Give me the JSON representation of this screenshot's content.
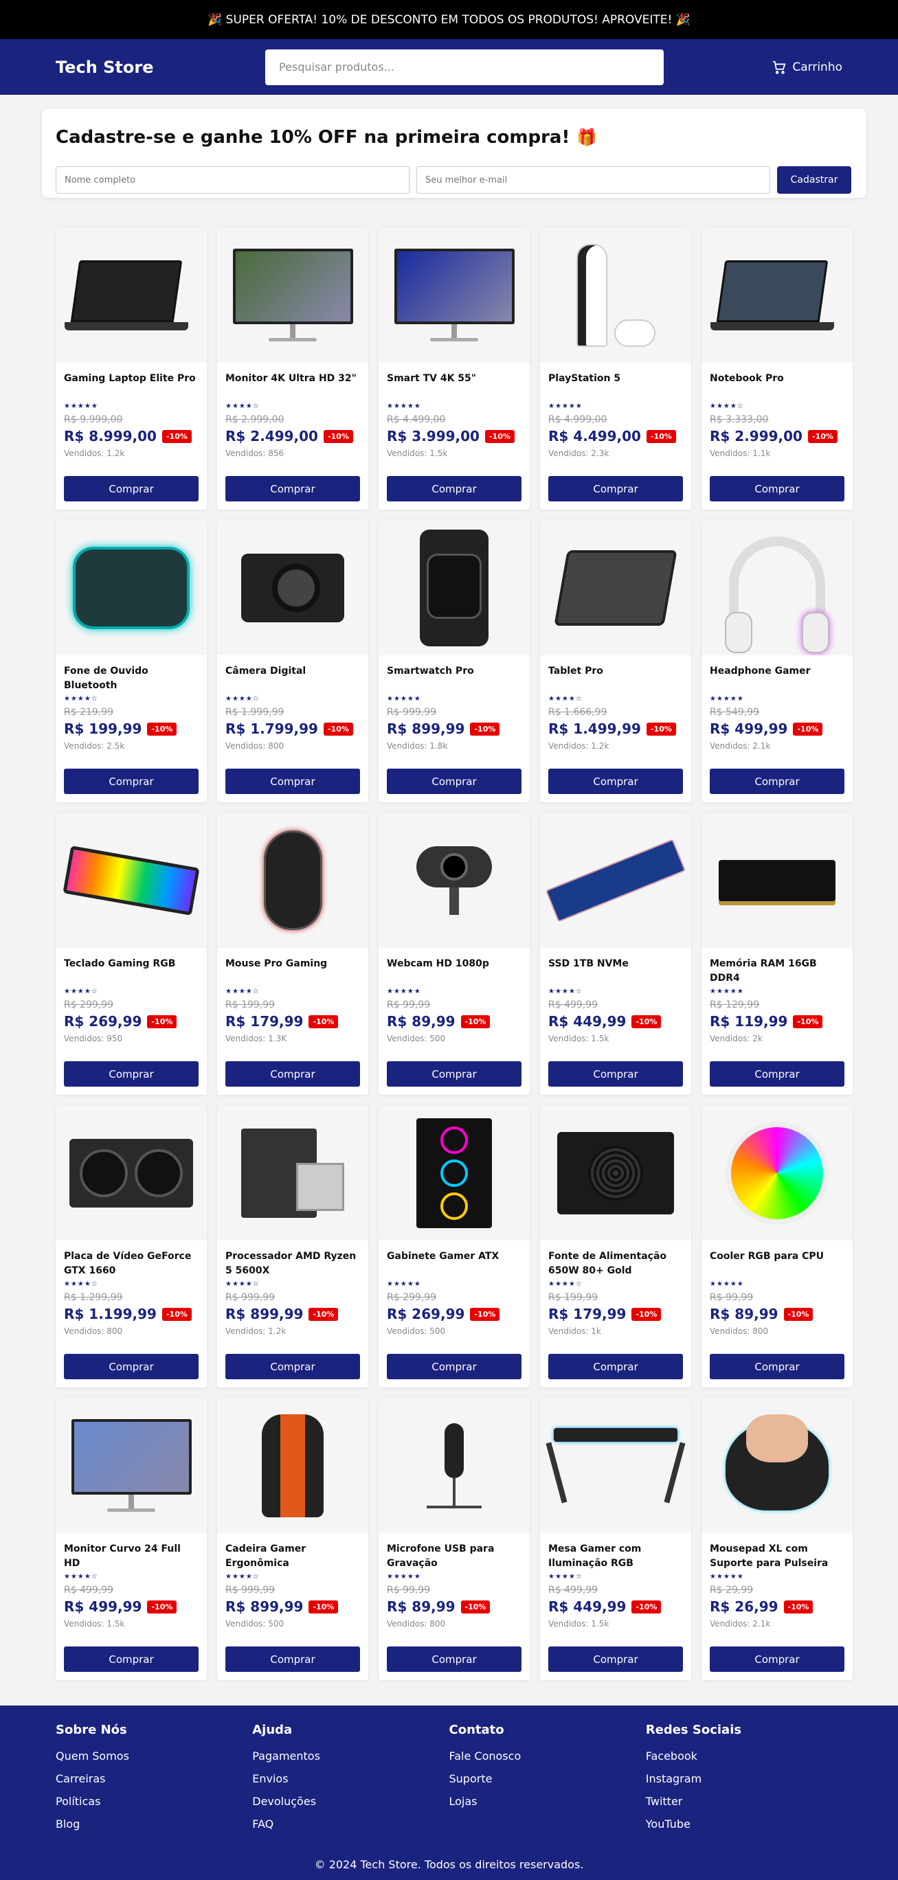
{
  "promo": {
    "text": "🎉 SUPER OFERTA! 10% DE DESCONTO EM TODOS OS PRODUTOS! APROVEITE! 🎉"
  },
  "header": {
    "logo": "Tech Store",
    "search_placeholder": "Pesquisar produtos...",
    "cart_label": "Carrinho"
  },
  "signup": {
    "title": "Cadastre-se e ganhe 10% OFF na primeira compra!",
    "name_placeholder": "Nome completo",
    "email_placeholder": "Seu melhor e-mail",
    "button": "Cadastrar"
  },
  "products": [
    {
      "name": "Gaming Laptop Elite Pro",
      "stars": "★★★★★",
      "old_price": "R$ 9.999,00",
      "price": "R$ 8.999,00",
      "badge": "-10%",
      "sold": "Vendidos: 1.2k",
      "buy": "Comprar",
      "icon": "laptop-icon",
      "color": "#222"
    },
    {
      "name": "Monitor 4K Ultra HD 32\"",
      "stars": "★★★★☆",
      "old_price": "R$ 2.999,00",
      "price": "R$ 2.499,00",
      "badge": "-10%",
      "sold": "Vendidos: 856",
      "buy": "Comprar",
      "icon": "monitor-icon",
      "color": "#4a6b3a"
    },
    {
      "name": "Smart TV 4K 55\"",
      "stars": "★★★★★",
      "old_price": "R$ 4.499,00",
      "price": "R$ 3.999,00",
      "badge": "-10%",
      "sold": "Vendidos: 1.5k",
      "buy": "Comprar",
      "icon": "tv-icon",
      "color": "#1a2a9e"
    },
    {
      "name": "PlayStation 5",
      "stars": "★★★★★",
      "old_price": "R$ 4.999,00",
      "price": "R$ 4.499,00",
      "badge": "-10%",
      "sold": "Vendidos: 2.3k",
      "buy": "Comprar",
      "icon": "console-icon",
      "color": "#e8e8ee"
    },
    {
      "name": "Notebook Pro",
      "stars": "★★★★☆",
      "old_price": "R$ 3.333,00",
      "price": "R$ 2.999,00",
      "badge": "-10%",
      "sold": "Vendidos: 1.1k",
      "buy": "Comprar",
      "icon": "notebook-icon",
      "color": "#3a4a5a"
    },
    {
      "name": "Fone de Ouvido Bluetooth",
      "stars": "★★★★☆",
      "old_price": "R$ 219,99",
      "price": "R$ 199,99",
      "badge": "-10%",
      "sold": "Vendidos: 2.5k",
      "buy": "Comprar",
      "icon": "earbuds-icon",
      "color": "#1e3a3a"
    },
    {
      "name": "Câmera Digital",
      "stars": "★★★★☆",
      "old_price": "R$ 1.999,99",
      "price": "R$ 1.799,99",
      "badge": "-10%",
      "sold": "Vendidos: 800",
      "buy": "Comprar",
      "icon": "camera-icon",
      "color": "#222"
    },
    {
      "name": "Smartwatch Pro",
      "stars": "★★★★★",
      "old_price": "R$ 999,99",
      "price": "R$ 899,99",
      "badge": "-10%",
      "sold": "Vendidos: 1.8k",
      "buy": "Comprar",
      "icon": "watch-icon",
      "color": "#333"
    },
    {
      "name": "Tablet Pro",
      "stars": "★★★★☆",
      "old_price": "R$ 1.666,99",
      "price": "R$ 1.499,99",
      "badge": "-10%",
      "sold": "Vendidos: 1.2k",
      "buy": "Comprar",
      "icon": "tablet-icon",
      "color": "#444"
    },
    {
      "name": "Headphone Gamer",
      "stars": "★★★★★",
      "old_price": "R$ 549,99",
      "price": "R$ 499,99",
      "badge": "-10%",
      "sold": "Vendidos: 2.1k",
      "buy": "Comprar",
      "icon": "headphone-icon",
      "color": "#ddd"
    },
    {
      "name": "Teclado Gaming RGB",
      "stars": "★★★★☆",
      "old_price": "R$ 299,99",
      "price": "R$ 269,99",
      "badge": "-10%",
      "sold": "Vendidos: 950",
      "buy": "Comprar",
      "icon": "keyboard-icon",
      "color": "#2a2a2a"
    },
    {
      "name": "Mouse Pro Gaming",
      "stars": "★★★★☆",
      "old_price": "R$ 199,99",
      "price": "R$ 179,99",
      "badge": "-10%",
      "sold": "Vendidos: 1.3K",
      "buy": "Comprar",
      "icon": "mouse-icon",
      "color": "#222"
    },
    {
      "name": "Webcam HD 1080p",
      "stars": "★★★★★",
      "old_price": "R$ 99,99",
      "price": "R$ 89,99",
      "badge": "-10%",
      "sold": "Vendidos: 500",
      "buy": "Comprar",
      "icon": "webcam-icon",
      "color": "#333"
    },
    {
      "name": "SSD 1TB NVMe",
      "stars": "★★★★☆",
      "old_price": "R$ 499,99",
      "price": "R$ 449,99",
      "badge": "-10%",
      "sold": "Vendidos: 1.5k",
      "buy": "Comprar",
      "icon": "ssd-icon",
      "color": "#1a3a8a"
    },
    {
      "name": "Memória RAM 16GB DDR4",
      "stars": "★★★★★",
      "old_price": "R$ 129,99",
      "price": "R$ 119,99",
      "badge": "-10%",
      "sold": "Vendidos: 2k",
      "buy": "Comprar",
      "icon": "ram-icon",
      "color": "#111"
    },
    {
      "name": "Placa de Vídeo GeForce GTX 1660",
      "stars": "★★★★☆",
      "old_price": "R$ 1.299,99",
      "price": "R$ 1.199,99",
      "badge": "-10%",
      "sold": "Vendidos: 800",
      "buy": "Comprar",
      "icon": "gpu-icon",
      "color": "#2a2a2a"
    },
    {
      "name": "Processador AMD Ryzen 5 5600X",
      "stars": "★★★★☆",
      "old_price": "R$ 999,99",
      "price": "R$ 899,99",
      "badge": "-10%",
      "sold": "Vendidos: 1.2k",
      "buy": "Comprar",
      "icon": "cpu-icon",
      "color": "#333"
    },
    {
      "name": "Gabinete Gamer ATX",
      "stars": "★★★★★",
      "old_price": "R$ 299,99",
      "price": "R$ 269,99",
      "badge": "-10%",
      "sold": "Vendidos: 500",
      "buy": "Comprar",
      "icon": "case-icon",
      "color": "#111"
    },
    {
      "name": "Fonte de Alimentação 650W 80+ Gold",
      "stars": "★★★★☆",
      "old_price": "R$ 199,99",
      "price": "R$ 179,99",
      "badge": "-10%",
      "sold": "Vendidos: 1k",
      "buy": "Comprar",
      "icon": "psu-icon",
      "color": "#1a1a1a"
    },
    {
      "name": "Cooler RGB para CPU",
      "stars": "★★★★★",
      "old_price": "R$ 99,99",
      "price": "R$ 89,99",
      "badge": "-10%",
      "sold": "Vendidos: 800",
      "buy": "Comprar",
      "icon": "cooler-icon",
      "color": "#9ad"
    },
    {
      "name": "Monitor Curvo 24 Full HD",
      "stars": "★★★★☆",
      "old_price": "R$ 499,99",
      "price": "R$ 499,99",
      "badge": "-10%",
      "sold": "Vendidos: 1.5k",
      "buy": "Comprar",
      "icon": "curved-monitor-icon",
      "color": "#6a8acf"
    },
    {
      "name": "Cadeira Gamer Ergonômica",
      "stars": "★★★★☆",
      "old_price": "R$ 999,99",
      "price": "R$ 899,99",
      "badge": "-10%",
      "sold": "Vendidos: 500",
      "buy": "Comprar",
      "icon": "chair-icon",
      "color": "#e0591a"
    },
    {
      "name": "Microfone USB para Gravação",
      "stars": "★★★★★",
      "old_price": "R$ 99,99",
      "price": "R$ 89,99",
      "badge": "-10%",
      "sold": "Vendidos: 800",
      "buy": "Comprar",
      "icon": "microphone-icon",
      "color": "#222"
    },
    {
      "name": "Mesa Gamer com Iluminação RGB",
      "stars": "★★★★☆",
      "old_price": "R$ 499,99",
      "price": "R$ 449,99",
      "badge": "-10%",
      "sold": "Vendidos: 1.5k",
      "buy": "Comprar",
      "icon": "desk-icon",
      "color": "#222"
    },
    {
      "name": "Mousepad XL com Suporte para Pulseira",
      "stars": "★★★★★",
      "old_price": "R$ 29,99",
      "price": "R$ 26,99",
      "badge": "-10%",
      "sold": "Vendidos: 2.1k",
      "buy": "Comprar",
      "icon": "mousepad-icon",
      "color": "#222"
    }
  ],
  "footer": {
    "columns": [
      {
        "title": "Sobre Nós",
        "links": [
          "Quem Somos",
          "Carreiras",
          "Políticas",
          "Blog"
        ]
      },
      {
        "title": "Ajuda",
        "links": [
          "Pagamentos",
          "Envios",
          "Devoluções",
          "FAQ"
        ]
      },
      {
        "title": "Contato",
        "links": [
          "Fale Conosco",
          "Suporte",
          "Lojas"
        ]
      },
      {
        "title": "Redes Sociais",
        "links": [
          "Facebook",
          "Instagram",
          "Twitter",
          "YouTube"
        ]
      }
    ],
    "copyright": "© 2024 Tech Store. Todos os direitos reservados."
  }
}
